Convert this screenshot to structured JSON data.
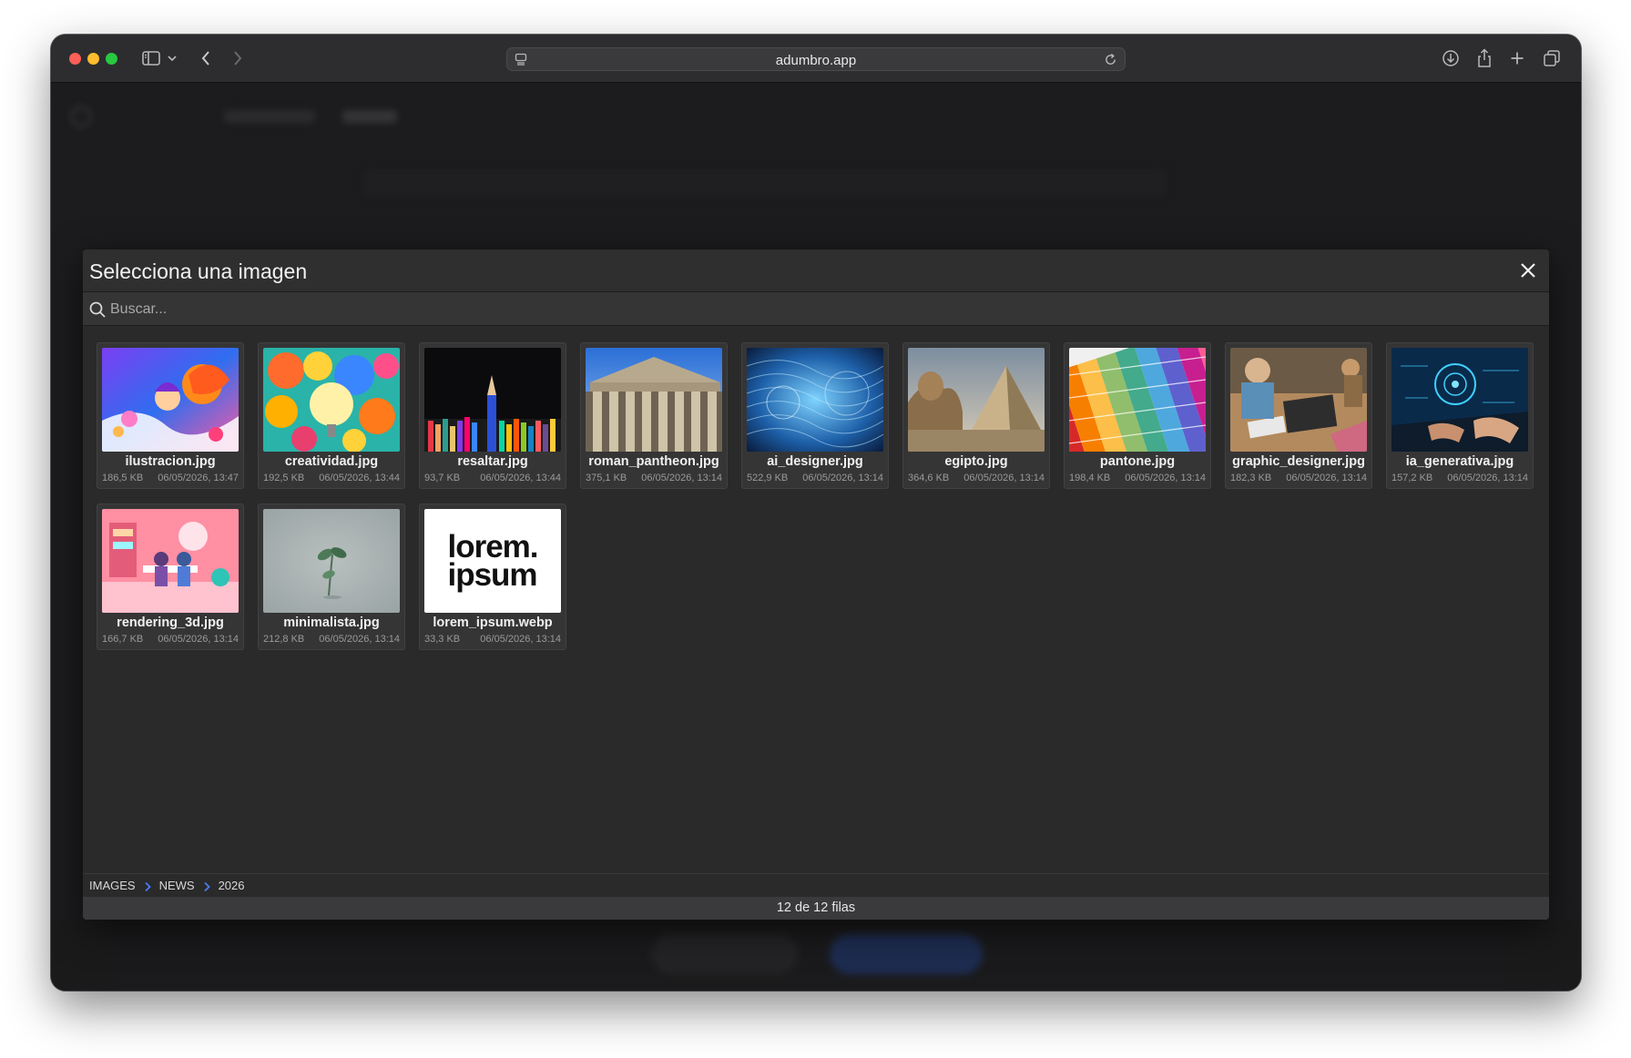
{
  "browser": {
    "url": "adumbro.app"
  },
  "modal": {
    "title": "Selecciona una imagen",
    "search_placeholder": "Buscar..."
  },
  "images": [
    {
      "name": "ilustracion.jpg",
      "size": "186,5 KB",
      "date": "06/05/2026, 13:47"
    },
    {
      "name": "creatividad.jpg",
      "size": "192,5 KB",
      "date": "06/05/2026, 13:44"
    },
    {
      "name": "resaltar.jpg",
      "size": "93,7 KB",
      "date": "06/05/2026, 13:44"
    },
    {
      "name": "roman_pantheon.jpg",
      "size": "375,1 KB",
      "date": "06/05/2026, 13:14"
    },
    {
      "name": "ai_designer.jpg",
      "size": "522,9 KB",
      "date": "06/05/2026, 13:14"
    },
    {
      "name": "egipto.jpg",
      "size": "364,6 KB",
      "date": "06/05/2026, 13:14"
    },
    {
      "name": "pantone.jpg",
      "size": "198,4 KB",
      "date": "06/05/2026, 13:14"
    },
    {
      "name": "graphic_designer.jpg",
      "size": "182,3 KB",
      "date": "06/05/2026, 13:14"
    },
    {
      "name": "ia_generativa.jpg",
      "size": "157,2 KB",
      "date": "06/05/2026, 13:14"
    },
    {
      "name": "rendering_3d.jpg",
      "size": "166,7 KB",
      "date": "06/05/2026, 13:14"
    },
    {
      "name": "minimalista.jpg",
      "size": "212,8 KB",
      "date": "06/05/2026, 13:14"
    },
    {
      "name": "lorem_ipsum.webp",
      "size": "33,3 KB",
      "date": "06/05/2026, 13:14",
      "thumb_text": [
        "lorem.",
        "ipsum"
      ]
    }
  ],
  "breadcrumb": [
    "IMAGES",
    "NEWS",
    "2026"
  ],
  "status": "12 de 12 filas",
  "colors": {
    "breadcrumb_separator": "#4a7dff"
  }
}
